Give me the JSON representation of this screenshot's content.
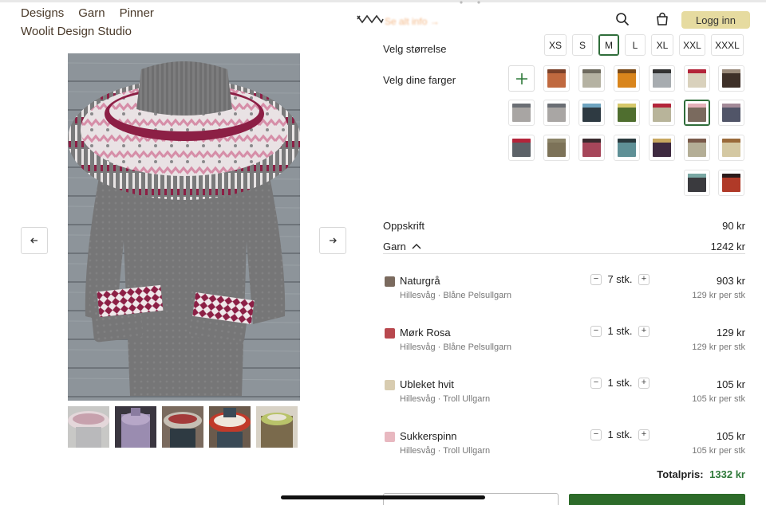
{
  "nav": {
    "items": [
      "Designs",
      "Garn",
      "Pinner"
    ],
    "brand": "Woolit Design Studio"
  },
  "header": {
    "ghost_text": "Se alt info →",
    "login_label": "Logg inn"
  },
  "gallery": {
    "swatches": [
      "#6e5a4c",
      "#b8484e",
      "#d8ccb0",
      "#e8b8c0"
    ],
    "thumb_count": 5
  },
  "size": {
    "label": "Velg størrelse",
    "options": [
      "XS",
      "S",
      "M",
      "L",
      "XL",
      "XXL",
      "XXXL"
    ],
    "selected": "M"
  },
  "colors": {
    "label": "Velg dine farger",
    "add_symbol": "+",
    "tiles": [
      {
        "main": "#c0693f",
        "top": "#7a4028"
      },
      {
        "main": "#b5b2a2",
        "top": "#6e6a5e"
      },
      {
        "main": "#d9851c",
        "top": "#7a4a18"
      },
      {
        "main": "#a7acb0",
        "top": "#333333"
      },
      {
        "main": "#d9d1bc",
        "top": "#b3243a"
      },
      {
        "main": "#3e3028",
        "top": "#9a8a7a"
      },
      {
        "main": "#a8a5a3",
        "top": "#6a6e74"
      },
      {
        "main": "#a9a6a4",
        "top": "#6a6e74"
      },
      {
        "main": "#2e3a42",
        "top": "#6fa4c0"
      },
      {
        "main": "#4f6e2f",
        "top": "#d6c86a"
      },
      {
        "main": "#b8b49a",
        "top": "#b3243a"
      },
      {
        "main": "#7a6a5e",
        "top": "#e4b0b8"
      },
      {
        "main": "#515568",
        "top": "#a38a98"
      },
      {
        "main": "#5c6268",
        "top": "#b3243a"
      },
      {
        "main": "#7c7258",
        "top": "#8c8468"
      },
      {
        "main": "#a6465a",
        "top": "#3a2a2e"
      },
      {
        "main": "#5f9096",
        "top": "#2a3a3e"
      },
      {
        "main": "#3e2a40",
        "top": "#c8a860"
      },
      {
        "main": "#b4ae96",
        "top": "#7a5a4a"
      },
      {
        "main": "#d4c8a2",
        "top": "#9a6a3a"
      },
      {
        "main": "#3a3a3e",
        "top": "#7aa8a4"
      },
      {
        "main": "#b03a28",
        "top": "#2a1a1a"
      }
    ],
    "selected_index": 11
  },
  "pricing": {
    "pattern_label": "Oppskrift",
    "pattern_price": "90 kr",
    "yarn_label": "Garn",
    "yarn_price": "1242 kr"
  },
  "yarns": [
    {
      "name": "Naturgrå",
      "sub": "Hillesvåg · Blåne Pelsullgarn",
      "qty": "7 stk.",
      "price": "903 kr",
      "unit": "129 kr per stk",
      "color": "#7a6a5e"
    },
    {
      "name": "Mørk Rosa",
      "sub": "Hillesvåg · Blåne Pelsullgarn",
      "qty": "1 stk.",
      "price": "129 kr",
      "unit": "129 kr per stk",
      "color": "#b8484e"
    },
    {
      "name": "Ubleket hvit",
      "sub": "Hillesvåg · Troll Ullgarn",
      "qty": "1 stk.",
      "price": "105 kr",
      "unit": "105 kr per stk",
      "color": "#d8ccb0"
    },
    {
      "name": "Sukkerspinn",
      "sub": "Hillesvåg · Troll Ullgarn",
      "qty": "1 stk.",
      "price": "105 kr",
      "unit": "105 kr per stk",
      "color": "#e8b8c0"
    }
  ],
  "qty_controls": {
    "minus": "−",
    "plus": "+"
  },
  "total": {
    "label": "Totalpris:",
    "amount": "1332 kr"
  }
}
